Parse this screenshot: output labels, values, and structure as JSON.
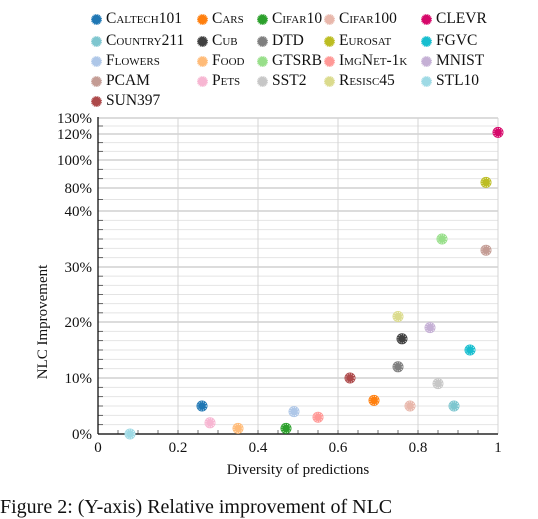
{
  "chart_data": {
    "type": "scatter",
    "xlabel": "Diversity of predictions",
    "ylabel": "NLC Improvement",
    "xlim": [
      0,
      1
    ],
    "xticks": [
      "0",
      "0.2",
      "0.4",
      "0.6",
      "0.8",
      "1"
    ],
    "yticks": [
      "0%",
      "10%",
      "20%",
      "30%",
      "40%",
      "80%",
      "100%",
      "120%",
      "130%"
    ],
    "ytick_values": [
      0,
      10,
      20,
      30,
      40,
      80,
      100,
      120,
      130
    ],
    "y_scale": "piecewise (non-uniform tick spacing)",
    "grid": true,
    "legend_position": "top",
    "series": [
      {
        "name": "Caltech101",
        "color": "#1f77b4",
        "x": 0.26,
        "y": 5
      },
      {
        "name": "Cars",
        "color": "#ff7f0e",
        "x": 0.69,
        "y": 6
      },
      {
        "name": "Cifar10",
        "color": "#2ca02c",
        "x": 0.47,
        "y": 1
      },
      {
        "name": "Cifar100",
        "color": "#e8b7ab",
        "x": 0.78,
        "y": 5
      },
      {
        "name": "CLEVR",
        "color": "#d6086a",
        "x": 1.0,
        "y": 121
      },
      {
        "name": "Country211",
        "color": "#7ec6cf",
        "x": 0.89,
        "y": 5
      },
      {
        "name": "Cub",
        "color": "#404040",
        "x": 0.76,
        "y": 17
      },
      {
        "name": "DTD",
        "color": "#7f7f7f",
        "x": 0.75,
        "y": 12
      },
      {
        "name": "Eurosat",
        "color": "#bcbd22",
        "x": 0.97,
        "y": 84
      },
      {
        "name": "FGVC",
        "color": "#17becf",
        "x": 0.93,
        "y": 15
      },
      {
        "name": "Flowers",
        "color": "#aec7e8",
        "x": 0.49,
        "y": 4
      },
      {
        "name": "Food",
        "color": "#ffbb78",
        "x": 0.35,
        "y": 1
      },
      {
        "name": "GTSRB",
        "color": "#98df8a",
        "x": 0.86,
        "y": 35
      },
      {
        "name": "ImgNet-1k",
        "color": "#ff9896",
        "x": 0.55,
        "y": 3
      },
      {
        "name": "MNIST",
        "color": "#c5b0d5",
        "x": 0.83,
        "y": 19
      },
      {
        "name": "PCAM",
        "color": "#c49c94",
        "x": 0.97,
        "y": 33
      },
      {
        "name": "Pets",
        "color": "#f7b6d2",
        "x": 0.28,
        "y": 2
      },
      {
        "name": "SST2",
        "color": "#c7c7c7",
        "x": 0.85,
        "y": 9
      },
      {
        "name": "Resisc45",
        "color": "#dbdb8d",
        "x": 0.75,
        "y": 21
      },
      {
        "name": "STL10",
        "color": "#9edae5",
        "x": 0.08,
        "y": 0
      },
      {
        "name": "SUN397",
        "color": "#ad494a",
        "x": 0.63,
        "y": 10
      }
    ]
  },
  "caption": "Figure 2: (Y-axis) Relative improvement of NLC"
}
